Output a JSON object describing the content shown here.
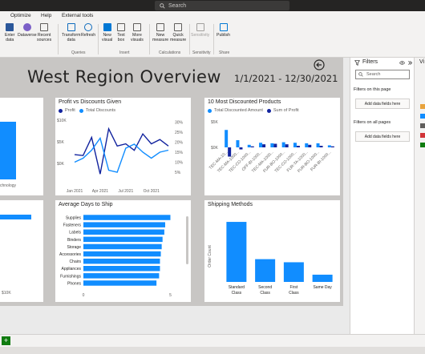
{
  "search": {
    "placeholder": "Search"
  },
  "menu": [
    "Optimize",
    "Help",
    "External tools"
  ],
  "ribbon": {
    "buttons": [
      {
        "label": "Enter\ndata",
        "color": "#2b579a"
      },
      {
        "label": "Dataverse",
        "color": "#7b5fc7"
      },
      {
        "label": "Recent\nsources",
        "color": "#605e5c"
      },
      {
        "label": "Transform\ndata",
        "color": "#0f6cbd"
      },
      {
        "label": "Refresh",
        "color": "#0f6cbd"
      },
      {
        "label": "New\nvisual",
        "color": "#0078d4"
      },
      {
        "label": "Text\nbox",
        "color": "#605e5c"
      },
      {
        "label": "More\nvisuals",
        "color": "#605e5c"
      },
      {
        "label": "New\nmeasure",
        "color": "#605e5c"
      },
      {
        "label": "Quick\nmeasure",
        "color": "#605e5c"
      },
      {
        "label": "Sensitivity",
        "color": "#a19f9d"
      },
      {
        "label": "Publish",
        "color": "#0078d4"
      }
    ],
    "groups": [
      "Queries",
      "Insert",
      "Calculations",
      "Sensitivity",
      "Share"
    ]
  },
  "report": {
    "title": "West Region Overview",
    "date_range": "1/1/2021 - 12/30/2021"
  },
  "tiles": {
    "profit_vs_discounts": {
      "title": "Profit vs Discounts Given",
      "legend": [
        "Profit",
        "Total Discounts"
      ]
    },
    "most_discounted": {
      "title": "10 Most Discounted Products",
      "legend": [
        "Total Discounted Amount",
        "Sum of Profit"
      ]
    },
    "days_to_ship": {
      "title": "Average Days to Ship"
    },
    "shipping_methods": {
      "title": "Shipping Methods"
    },
    "left_top": {
      "label": "chnology"
    },
    "left_bottom": {
      "label": "$10K"
    }
  },
  "filters": {
    "title": "Filters",
    "search": "Search",
    "on_this_page": "Filters on this page",
    "on_all_pages": "Filters on all pages",
    "add_fields": "Add data fields here"
  },
  "viz_pane": {
    "title": "Vi"
  },
  "colors": {
    "dark_blue": "#12239e",
    "light_blue": "#118dff",
    "accent_green": "#107c10"
  },
  "chart_data": [
    {
      "type": "line",
      "title": "Profit vs Discounts Given",
      "x": [
        "Jan 2021",
        "Feb 2021",
        "Mar 2021",
        "Apr 2021",
        "May 2021",
        "Jun 2021",
        "Jul 2021",
        "Aug 2021",
        "Sep 2021",
        "Oct 2021",
        "Nov 2021",
        "Dec 2021"
      ],
      "xticks": [
        "Jan 2021",
        "Apr 2021",
        "Jul 2021",
        "Oct 2021"
      ],
      "series": [
        {
          "name": "Profit",
          "axis": "left",
          "values": [
            2.0,
            1.8,
            6.0,
            -2.5,
            8.0,
            4.0,
            4.5,
            3.0,
            6.8,
            4.5,
            5.5,
            4.0
          ]
        },
        {
          "name": "Total Discounts",
          "axis": "right",
          "values": [
            10,
            12,
            16,
            22,
            6,
            5,
            17,
            19,
            15,
            12,
            15,
            16
          ]
        }
      ],
      "yticks_left": [
        "$10K",
        "$5K",
        "$0K"
      ],
      "yticks_right": [
        "30%",
        "25%",
        "20%",
        "15%",
        "10%",
        "5%"
      ],
      "ylim_left": [
        -3,
        10
      ],
      "ylim_right": [
        3,
        31
      ]
    },
    {
      "type": "bar",
      "title": "10 Most Discounted Products",
      "categories": [
        "TEC-MA-10...",
        "TEC-MA-1000...",
        "TEC-CO-1000...",
        "OFF-BI-1000...",
        "TEC-MA-1000...",
        "FUR-BO-1000...",
        "TEC-CO-1000...",
        "FUR-TA-1000...",
        "FUR-BO-1000...",
        "FUR-BI-1000..."
      ],
      "series": [
        {
          "name": "Total Discounted Amount",
          "values": [
            3.4,
            1.4,
            0.5,
            0.9,
            0.8,
            1.0,
            0.9,
            0.8,
            0.8,
            0.4
          ]
        },
        {
          "name": "Sum of Profit",
          "values": [
            -1.8,
            -0.4,
            0.2,
            0.6,
            0.7,
            0.6,
            0.3,
            0.5,
            0.3,
            0.2
          ]
        }
      ],
      "yticks": [
        "$5K",
        "$0K"
      ],
      "ylim": [
        -2.5,
        5
      ]
    },
    {
      "type": "bar",
      "orientation": "horizontal",
      "title": "Average Days to Ship",
      "categories": [
        "Supplies",
        "Fasteners",
        "Labels",
        "Binders",
        "Storage",
        "Accessories",
        "Chairs",
        "Appliances",
        "Furnishings",
        "Phones"
      ],
      "values": [
        5.0,
        4.7,
        4.65,
        4.55,
        4.5,
        4.45,
        4.4,
        4.4,
        4.35,
        4.2
      ],
      "xticks": [
        "0",
        "5"
      ],
      "xlim": [
        0,
        5.3
      ]
    },
    {
      "type": "bar",
      "title": "Shipping Methods",
      "categories": [
        "Standard Class",
        "Second Class",
        "First Class",
        "Same Day"
      ],
      "values": [
        580,
        220,
        190,
        70
      ],
      "ylabel": "Order Count",
      "ylim": [
        0,
        650
      ]
    }
  ]
}
